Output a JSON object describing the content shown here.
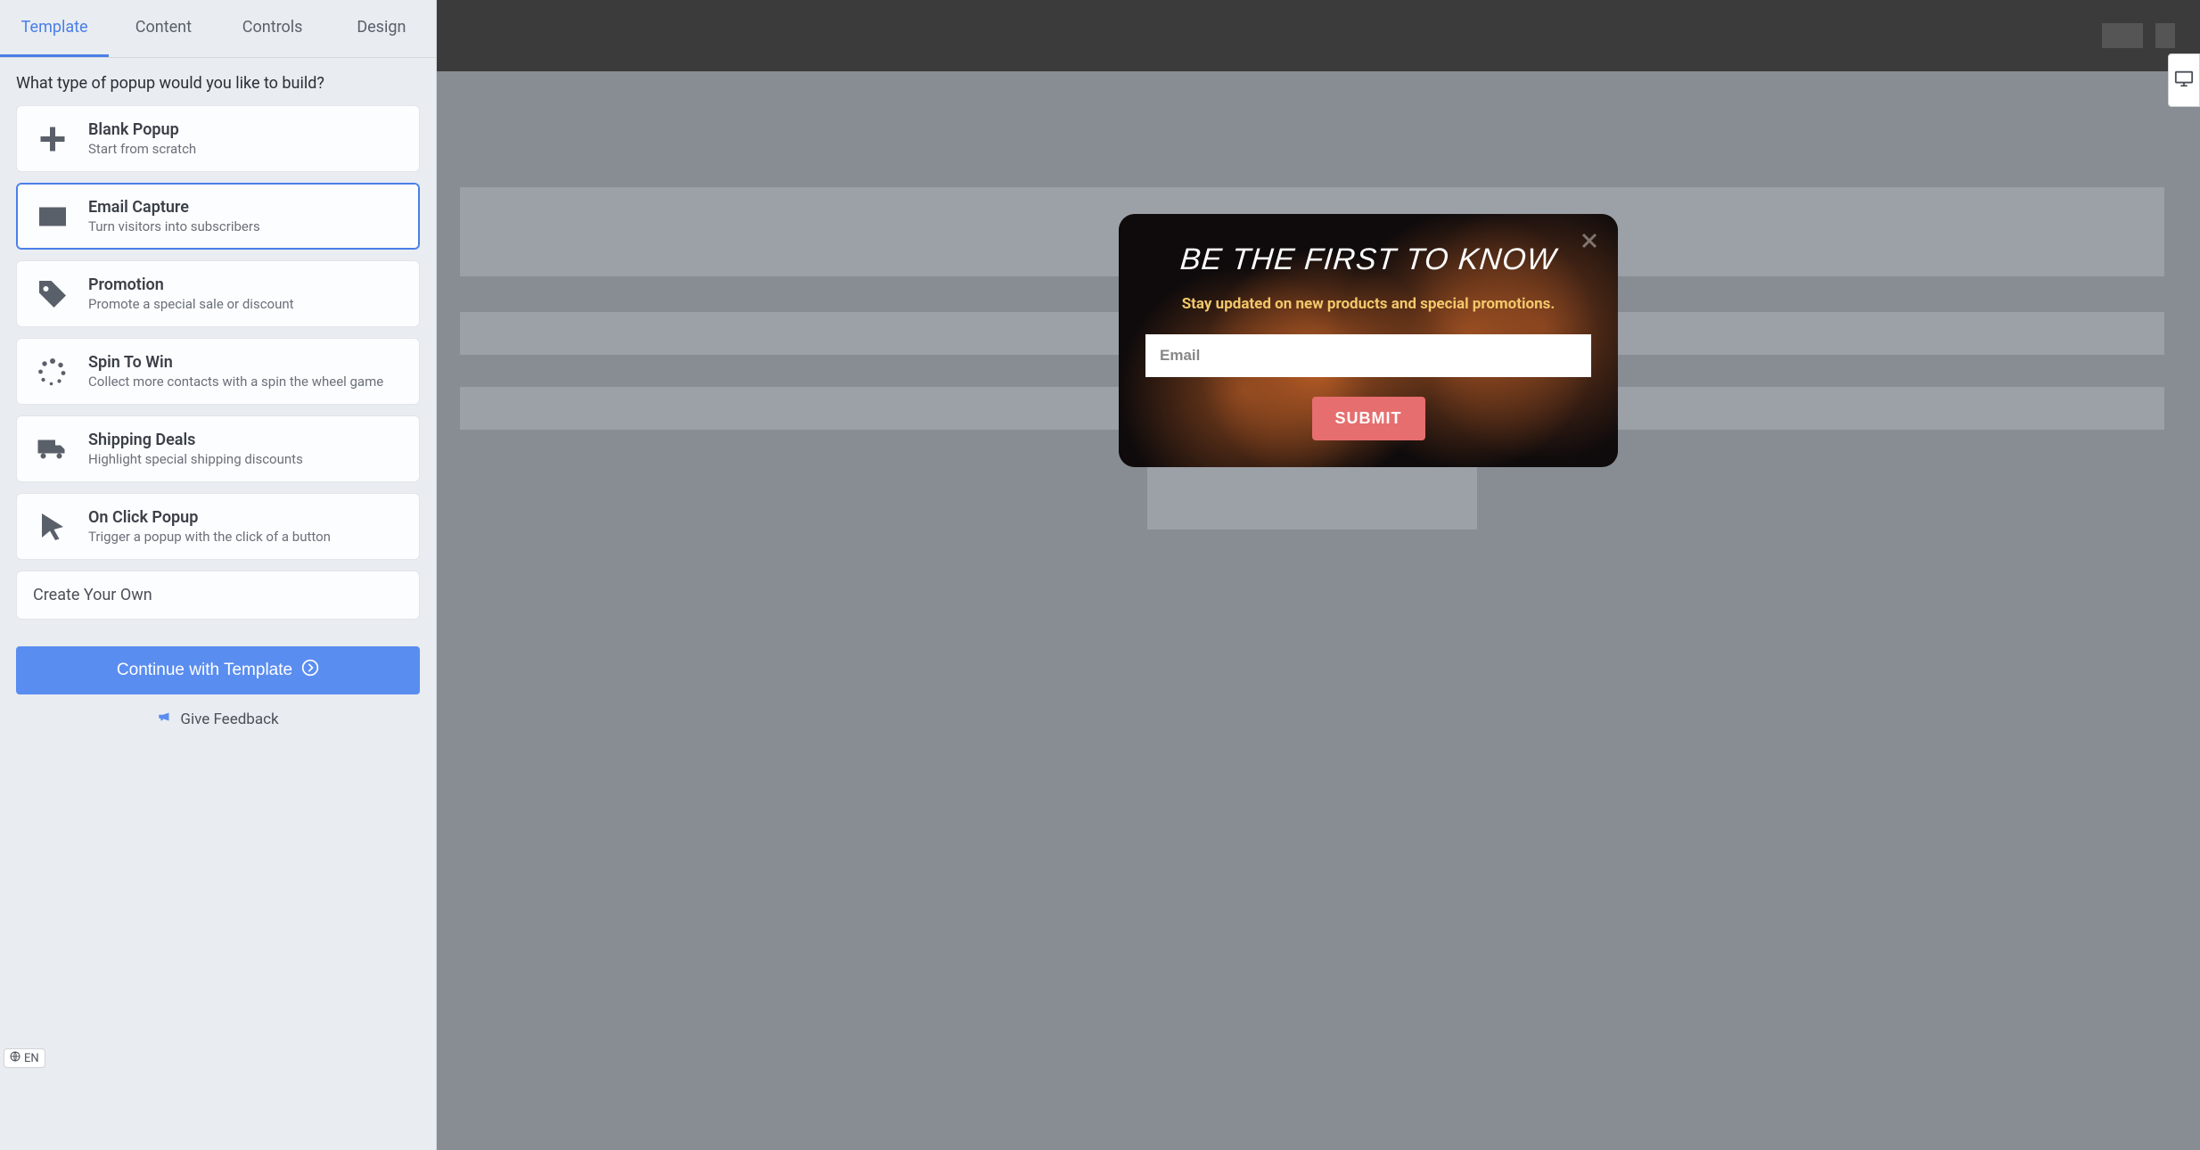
{
  "tabs": [
    "Template",
    "Content",
    "Controls",
    "Design"
  ],
  "active_tab_index": 0,
  "prompt": "What type of popup would you like to build?",
  "options": [
    {
      "icon": "plus-icon",
      "title": "Blank Popup",
      "desc": "Start from scratch"
    },
    {
      "icon": "envelope-icon",
      "title": "Email Capture",
      "desc": "Turn visitors into subscribers"
    },
    {
      "icon": "tag-icon",
      "title": "Promotion",
      "desc": "Promote a special sale or discount"
    },
    {
      "icon": "spinner-icon",
      "title": "Spin To Win",
      "desc": "Collect more contacts with a spin the wheel game"
    },
    {
      "icon": "truck-icon",
      "title": "Shipping Deals",
      "desc": "Highlight special shipping discounts"
    },
    {
      "icon": "cursor-icon",
      "title": "On Click Popup",
      "desc": "Trigger a popup with the click of a button"
    }
  ],
  "selected_option_index": 1,
  "create_own_label": "Create Your Own",
  "language_label": "EN",
  "continue_label": "Continue with Template",
  "feedback_label": "Give Feedback",
  "popup": {
    "title": "BE THE FIRST TO KNOW",
    "subtitle": "Stay updated on new products and special promotions.",
    "email_placeholder": "Email",
    "submit_label": "SUBMIT"
  }
}
